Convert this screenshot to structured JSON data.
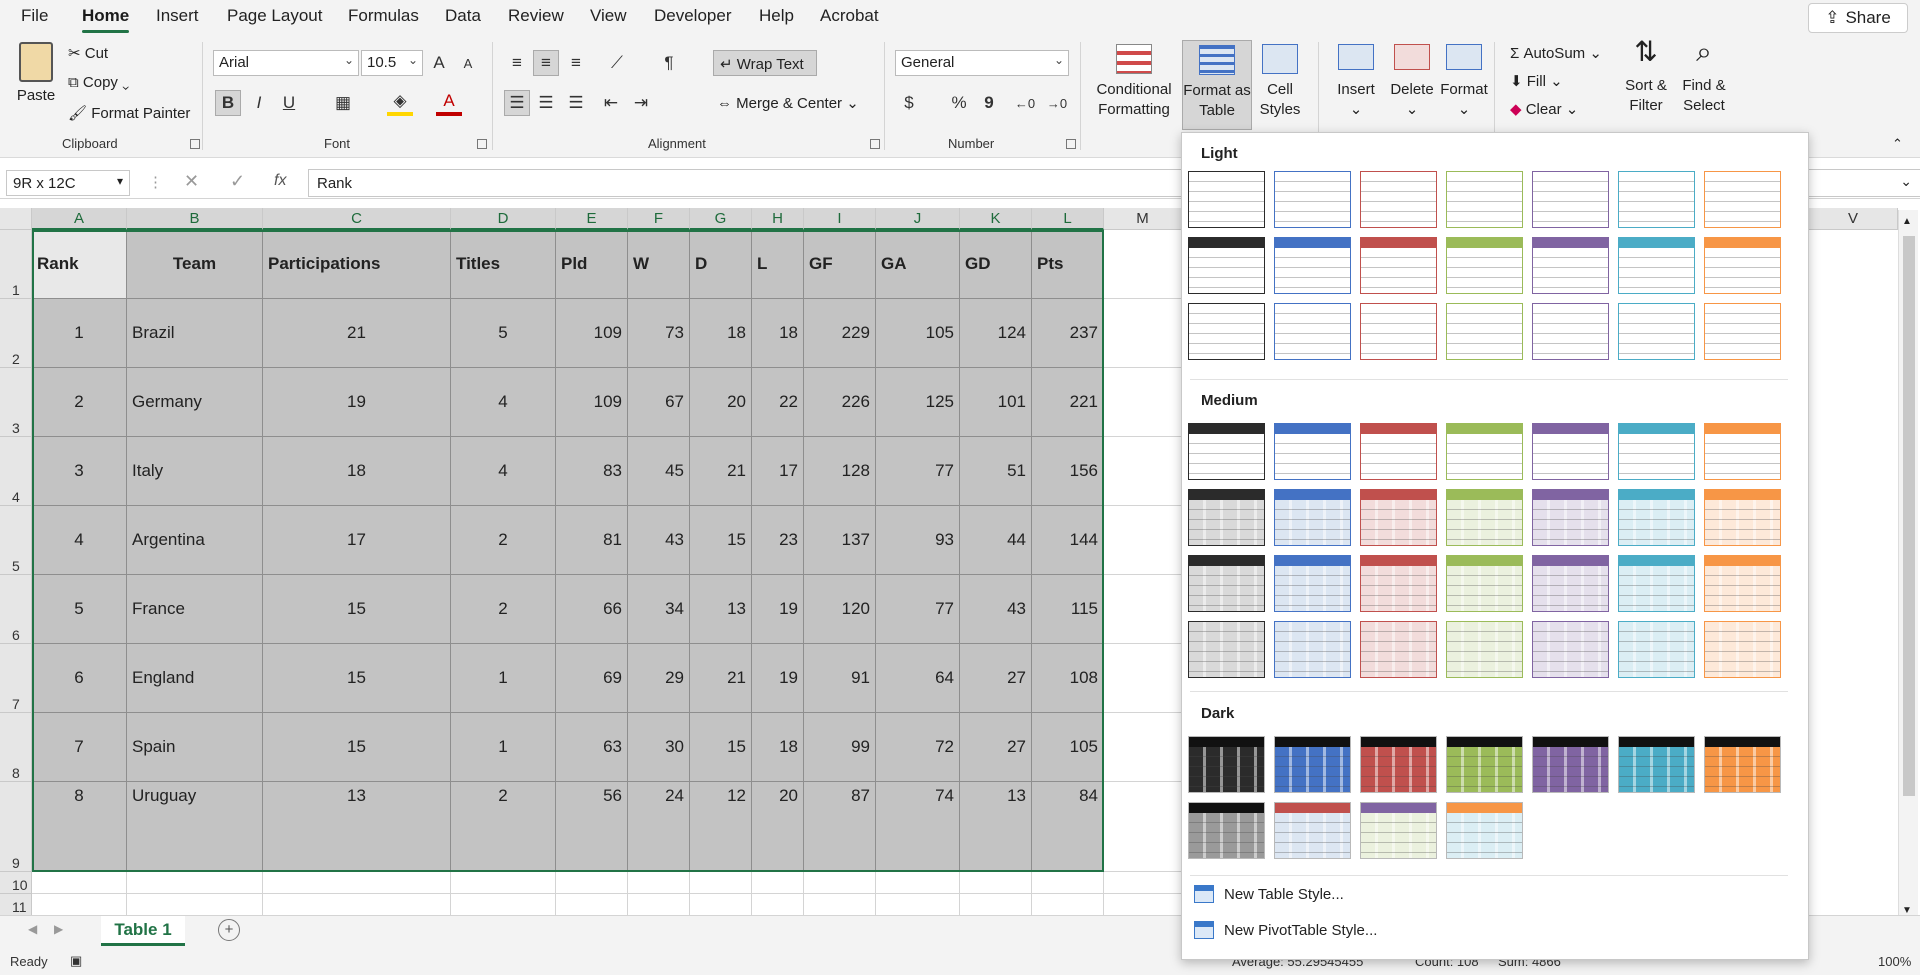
{
  "menu": {
    "tabs": [
      "File",
      "Home",
      "Insert",
      "Page Layout",
      "Formulas",
      "Data",
      "Review",
      "View",
      "Developer",
      "Help",
      "Acrobat"
    ],
    "share": "Share"
  },
  "ribbon": {
    "clipboard": {
      "paste": "Paste",
      "cut": "Cut",
      "copy": "Copy",
      "format_painter": "Format Painter",
      "label": "Clipboard"
    },
    "font": {
      "name": "Arial",
      "size": "10.5",
      "label": "Font",
      "bold": "B",
      "italic": "I",
      "underline": "U",
      "grow": "A",
      "shrink": "A",
      "font_color": "A"
    },
    "alignment": {
      "wrap": "Wrap Text",
      "merge": "Merge & Center",
      "label": "Alignment"
    },
    "number": {
      "format": "General",
      "currency": "$",
      "percent": "%",
      "comma": "9",
      "label": "Number"
    },
    "styles": {
      "conditional": "Conditional",
      "conditional2": "Formatting",
      "format_as": "Format as",
      "format_as2": "Table",
      "cell": "Cell",
      "cell2": "Styles"
    },
    "cells": {
      "insert": "Insert",
      "delete": "Delete",
      "format": "Format"
    },
    "editing": {
      "autosum": "AutoSum",
      "fill": "Fill",
      "clear": "Clear",
      "sort": "Sort &",
      "sort2": "Filter",
      "find": "Find &",
      "find2": "Select"
    }
  },
  "formula_bar": {
    "name_box": "9R x 12C",
    "fx": "fx",
    "value": "Rank"
  },
  "columns": [
    "A",
    "B",
    "C",
    "D",
    "E",
    "F",
    "G",
    "H",
    "I",
    "J",
    "K",
    "L",
    "M",
    "V"
  ],
  "rows": [
    "1",
    "2",
    "3",
    "4",
    "5",
    "6",
    "7",
    "8",
    "9",
    "10",
    "11"
  ],
  "table": {
    "headers": [
      "Rank",
      "Team",
      "Participations",
      "Titles",
      "Pld",
      "W",
      "D",
      "L",
      "GF",
      "GA",
      "GD",
      "Pts"
    ],
    "rows": [
      [
        "1",
        "Brazil",
        "21",
        "5",
        "109",
        "73",
        "18",
        "18",
        "229",
        "105",
        "124",
        "237"
      ],
      [
        "2",
        "Germany",
        "19",
        "4",
        "109",
        "67",
        "20",
        "22",
        "226",
        "125",
        "101",
        "221"
      ],
      [
        "3",
        "Italy",
        "18",
        "4",
        "83",
        "45",
        "21",
        "17",
        "128",
        "77",
        "51",
        "156"
      ],
      [
        "4",
        "Argentina",
        "17",
        "2",
        "81",
        "43",
        "15",
        "23",
        "137",
        "93",
        "44",
        "144"
      ],
      [
        "5",
        "France",
        "15",
        "2",
        "66",
        "34",
        "13",
        "19",
        "120",
        "77",
        "43",
        "115"
      ],
      [
        "6",
        "England",
        "15",
        "1",
        "69",
        "29",
        "21",
        "19",
        "91",
        "64",
        "27",
        "108"
      ],
      [
        "7",
        "Spain",
        "15",
        "1",
        "63",
        "30",
        "15",
        "18",
        "99",
        "72",
        "27",
        "105"
      ],
      [
        "8",
        "Uruguay",
        "13",
        "2",
        "56",
        "24",
        "12",
        "20",
        "87",
        "74",
        "13",
        "84"
      ]
    ]
  },
  "sheet_tab": "Table 1",
  "status": {
    "ready": "Ready",
    "average": "Average: 55.29545455",
    "count": "Count: 108",
    "sum": "Sum: 4866",
    "zoom": "100%"
  },
  "gallery": {
    "light": "Light",
    "medium": "Medium",
    "dark": "Dark",
    "new_table_style": "New Table Style...",
    "new_pivot_style": "New PivotTable Style...",
    "palette": [
      "#2b2b2b",
      "#4472c4",
      "#c0504d",
      "#9bbb59",
      "#8064a2",
      "#4bacc6",
      "#f79646"
    ],
    "tints": [
      "#d9d9d9",
      "#dce6f2",
      "#f2dcdb",
      "#ebf1de",
      "#e5e0ec",
      "#dbeef4",
      "#fde9d9"
    ]
  }
}
